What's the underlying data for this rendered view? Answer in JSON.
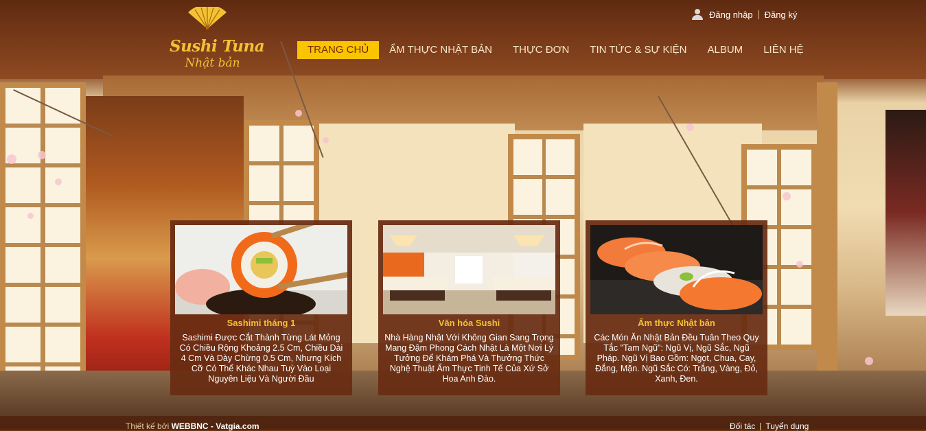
{
  "logo": {
    "title": "Sushi Tuna",
    "subtitle": "Nhật bản"
  },
  "auth": {
    "login": "Đăng nhập",
    "register": "Đăng ký"
  },
  "nav": {
    "items": [
      {
        "label": "TRANG CHỦ",
        "active": true
      },
      {
        "label": "ẨM THỰC NHẬT BẢN"
      },
      {
        "label": "THỰC ĐƠN"
      },
      {
        "label": "TIN TỨC & SỰ KIỆN"
      },
      {
        "label": "ALBUM"
      },
      {
        "label": "LIÊN HỆ"
      }
    ]
  },
  "cards": [
    {
      "title": "Sashimi tháng 1",
      "text": "Sashimi Được Cắt Thành Từng Lát Mỏng Có Chiều Rộng Khoảng 2.5 Cm, Chiều Dài 4 Cm Và Dày Chừng 0.5 Cm, Nhưng Kích Cỡ Có Thể Khác Nhau Tuỳ Vào Loại Nguyên Liệu Và Người Đầu",
      "image": "sushi-roll-photo"
    },
    {
      "title": "Văn hóa Sushi",
      "text": "Nhà Hàng Nhật Với Không Gian Sang Trọng Mang Đậm Phong Cách Nhật Là Một Nơi Lý Tưởng Để Khám Phá Và Thưởng Thức Nghệ Thuật Ẩm Thực Tinh Tế Của Xứ Sở Hoa Anh Đào.",
      "image": "restaurant-interior-photo"
    },
    {
      "title": "Ẩm thực Nhật bản",
      "text": "Các Món Ăn Nhật Bản Đều Tuân Theo Quy Tắc \"Tam Ngũ\": Ngũ Vị, Ngũ Sắc, Ngũ Pháp. Ngũ Vị Bao Gồm: Ngọt, Chua, Cay, Đắng, Mặn. Ngũ Sắc Có: Trắng, Vàng, Đỏ, Xanh, Đen.",
      "image": "nigiri-sushi-photo"
    }
  ],
  "footer": {
    "designed_by_label": "Thiết kế bởi",
    "designed_by": "WEBBNC - Vatgia.com",
    "links": [
      "Đối tác",
      "Tuyển dụng"
    ]
  },
  "colors": {
    "accent": "#f9c400",
    "gold": "#f3c233",
    "card_bg": "#682c12"
  }
}
